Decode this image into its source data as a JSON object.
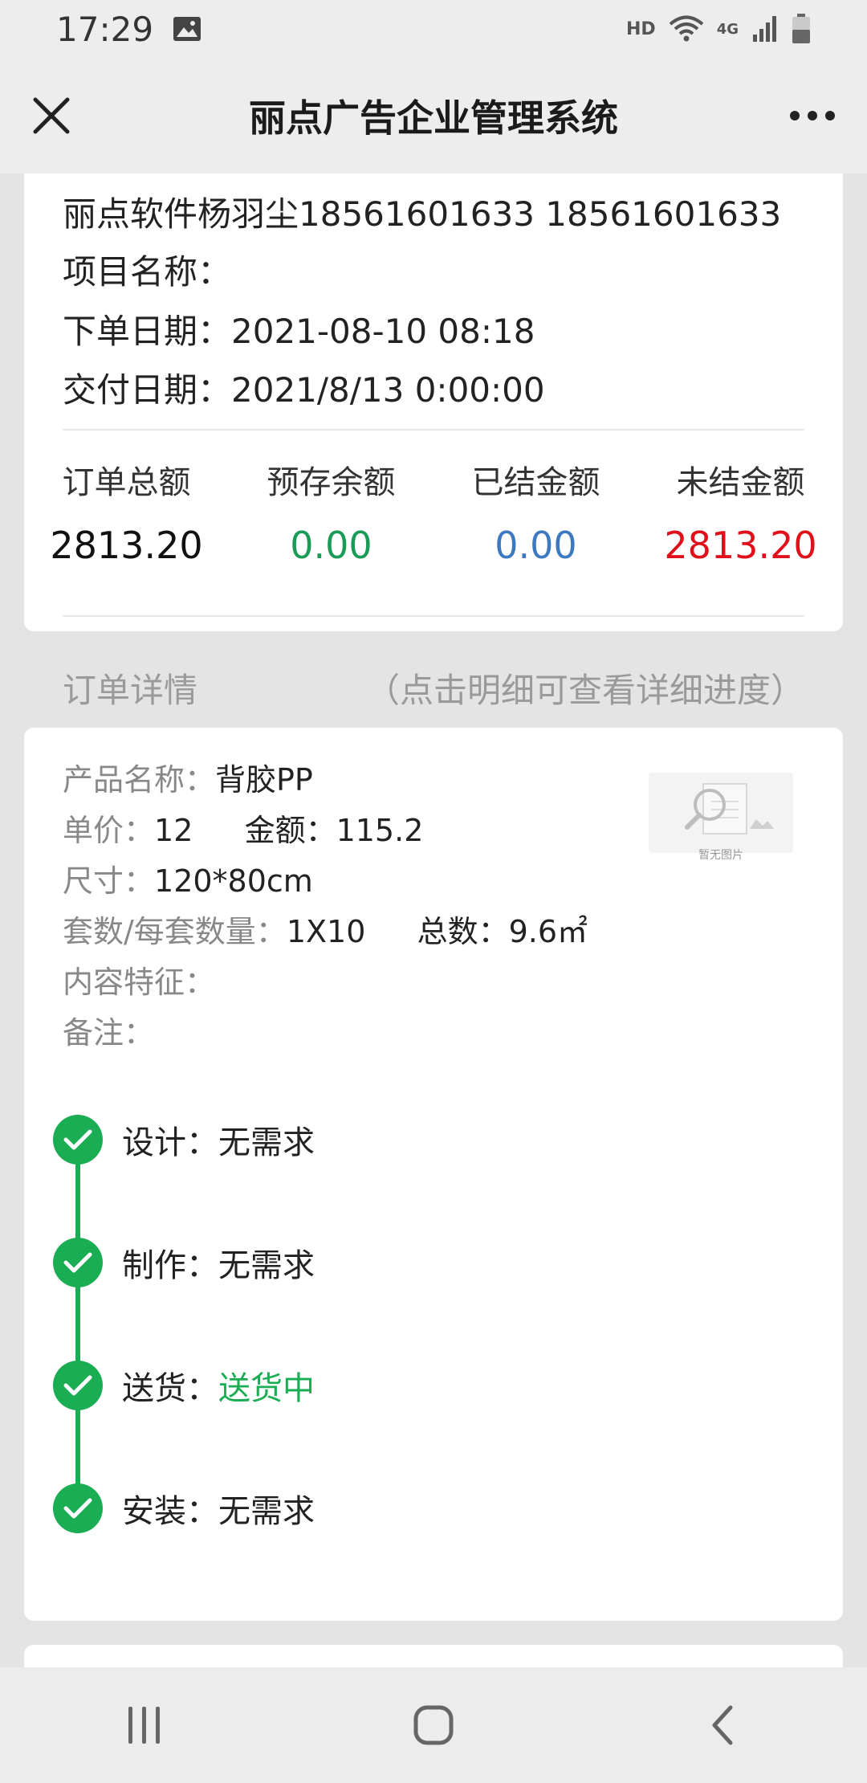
{
  "status_bar": {
    "time": "17:29",
    "image_icon": "image-icon",
    "hd_label": "HD",
    "network_label": "4G"
  },
  "title_bar": {
    "title": "丽点广告企业管理系统",
    "close_icon": "close-icon",
    "more_icon": "more-icon"
  },
  "order_info": {
    "customer": "丽点软件杨羽尘18561601633 18561601633",
    "project_name": "项目名称：",
    "order_date": "下单日期：2021-08-10 08:18",
    "delivery_date": "交付日期：2021/8/13 0:00:00"
  },
  "totals": [
    {
      "label": "订单总额",
      "value": "2813.20",
      "color": "#111111"
    },
    {
      "label": "预存余额",
      "value": "0.00",
      "color": "#1a9b57"
    },
    {
      "label": "已结金额",
      "value": "0.00",
      "color": "#3d79c0"
    },
    {
      "label": "未结金额",
      "value": "2813.20",
      "color": "#e0101b"
    }
  ],
  "section": {
    "title": "订单详情",
    "hint": "（点击明细可查看详细进度）"
  },
  "item": {
    "product_label": "产品名称：",
    "product_value": "背胶PP",
    "price_label": "单价：",
    "price_value": "12",
    "amount_label": "金额：",
    "amount_value": "115.2",
    "size_label": "尺寸：",
    "size_value": "120*80cm",
    "sets_label": "套数/每套数量：",
    "sets_value": "1X10",
    "total_label": "总数：",
    "total_value": "9.6㎡",
    "content_label": "内容特征：",
    "note_label": "备注：",
    "no_image_text": "暂无图片"
  },
  "steps": [
    {
      "label": "设计：",
      "status": "无需求",
      "status_color": "#222222"
    },
    {
      "label": "制作：",
      "status": "无需求",
      "status_color": "#222222"
    },
    {
      "label": "送货：",
      "status": "送货中",
      "status_color": "#1aad53"
    },
    {
      "label": "安装：",
      "status": "无需求",
      "status_color": "#222222"
    }
  ],
  "colors": {
    "accent_green": "#1aad53",
    "background": "#e4e4e4",
    "card": "#ffffff"
  },
  "nav": {
    "recent_icon": "recent-apps-icon",
    "home_icon": "home-icon",
    "back_icon": "back-icon"
  }
}
